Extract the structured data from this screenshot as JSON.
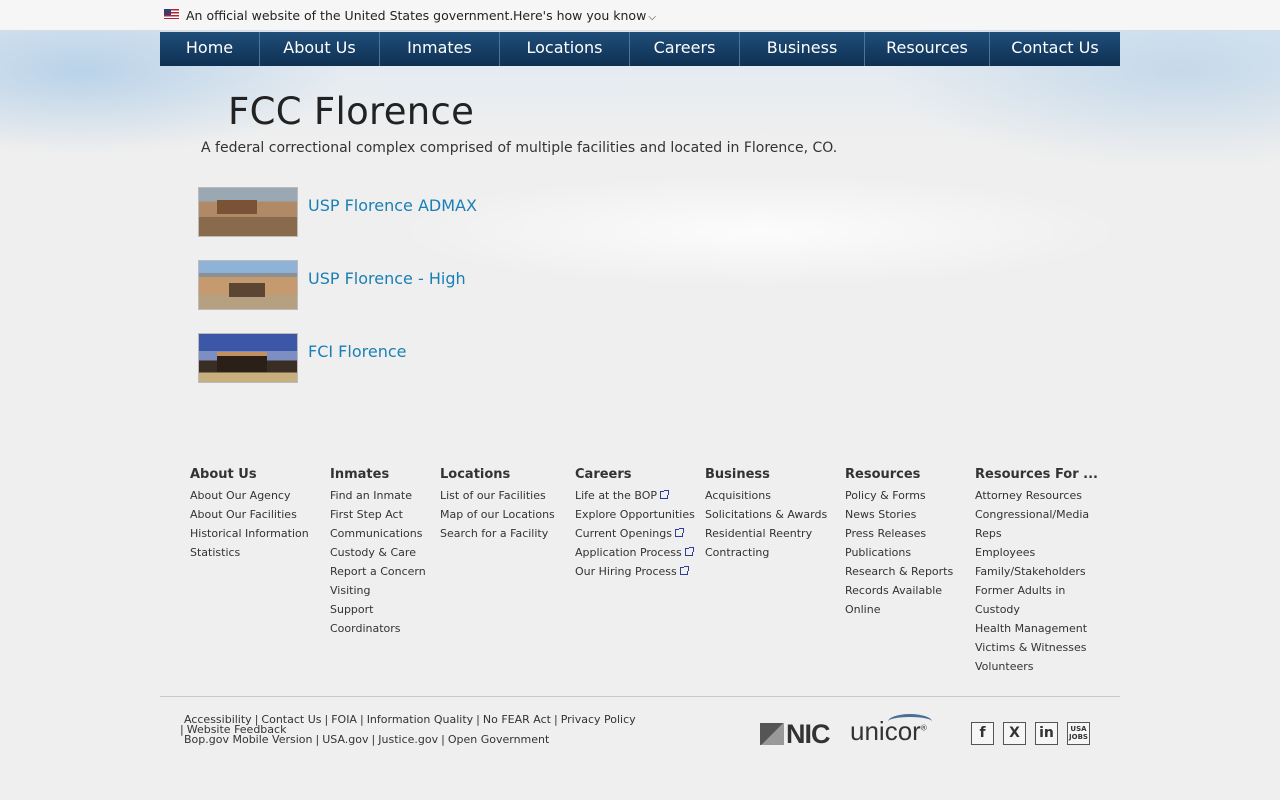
{
  "gov_banner": {
    "official_text": "An official website of the United States government.",
    "how_to_know": "Here's how you know"
  },
  "nav": [
    {
      "label": "Home"
    },
    {
      "label": "About Us"
    },
    {
      "label": "Inmates"
    },
    {
      "label": "Locations"
    },
    {
      "label": "Careers"
    },
    {
      "label": "Business"
    },
    {
      "label": "Resources"
    },
    {
      "label": "Contact Us"
    }
  ],
  "page": {
    "title": "FCC Florence",
    "subtitle": "A federal correctional complex comprised of multiple facilities and located in Florence, CO."
  },
  "facilities": [
    {
      "name": "USP Florence ADMAX"
    },
    {
      "name": "USP Florence - High"
    },
    {
      "name": "FCI Florence"
    }
  ],
  "footer": {
    "columns": [
      {
        "heading": "About Us",
        "links": [
          "About Our Agency",
          "About Our Facilities",
          "Historical Information",
          "Statistics"
        ]
      },
      {
        "heading": "Inmates",
        "links": [
          "Find an Inmate",
          "First Step Act",
          "Communications",
          "Custody & Care",
          "Report a Concern",
          "Visiting",
          "Support",
          "Coordinators"
        ]
      },
      {
        "heading": "Locations",
        "links": [
          "List of our Facilities",
          "Map of our Locations",
          "Search for a Facility"
        ]
      },
      {
        "heading": "Careers",
        "links": [
          "Life at the BOP",
          "Explore Opportunities",
          "Current Openings",
          "Application Process",
          "Our Hiring Process"
        ]
      },
      {
        "heading": "Business",
        "links": [
          "Acquisitions",
          "Solicitations & Awards",
          "Residential Reentry",
          "Contracting"
        ]
      },
      {
        "heading": "Resources",
        "links": [
          "Policy & Forms",
          "News Stories",
          "Press Releases",
          "Publications",
          "Research & Reports",
          "Records Available",
          "Online"
        ]
      },
      {
        "heading": "Resources For ...",
        "links": [
          "Attorney Resources",
          "Congressional/Media",
          "Reps",
          "Employees",
          "Family/Stakeholders",
          "Former Adults in",
          "Custody",
          "Health Management",
          "Victims & Witnesses",
          "Volunteers"
        ]
      }
    ],
    "bottom_links": {
      "accessibility": "Accessibility",
      "contact": "Contact Us",
      "foia": "FOIA",
      "info_quality": "Information Quality",
      "no_fear": "No FEAR Act",
      "privacy": "Privacy Policy",
      "feedback": "Website Feedback",
      "mobile": "Bop.gov Mobile Version",
      "usagov": "USA.gov",
      "justice": "Justice.gov",
      "open_gov": "Open Government"
    },
    "logos": {
      "nic": "NIC",
      "unicor": "unicor"
    },
    "social": {
      "facebook": "f",
      "x": "X",
      "linkedin": "in",
      "usajobs_1": "USA",
      "usajobs_2": "JOBS"
    }
  }
}
